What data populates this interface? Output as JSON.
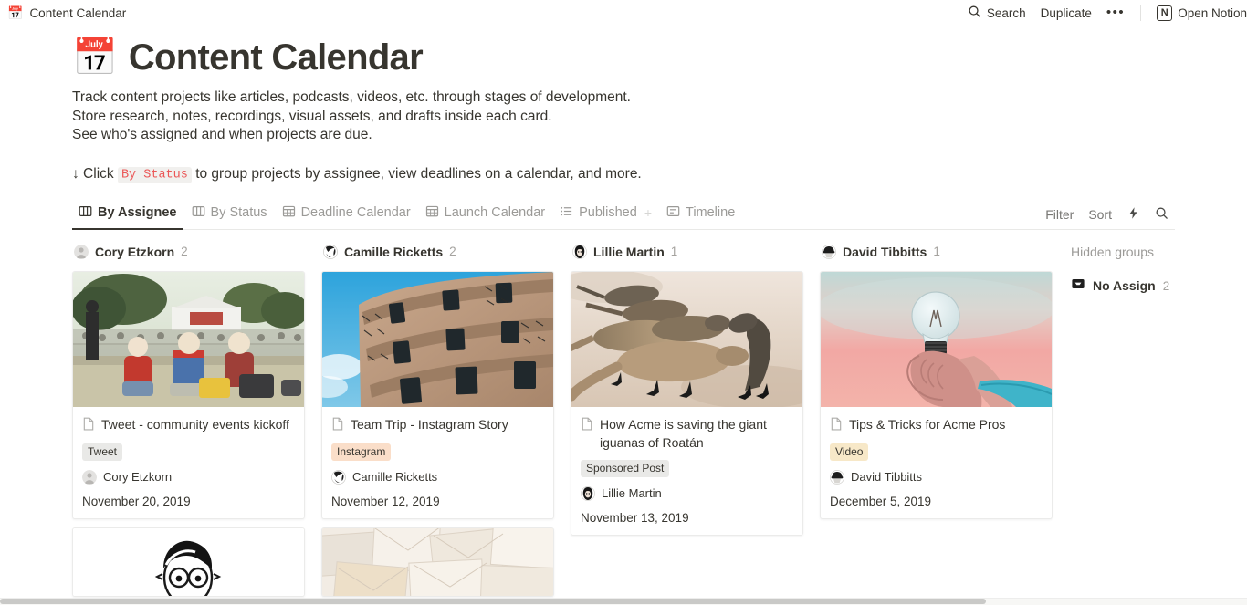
{
  "topbar": {
    "icon": "calendar-emoji",
    "title": "Content Calendar",
    "search_label": "Search",
    "search_icon": "search-icon",
    "duplicate_label": "Duplicate",
    "more_label": "•••",
    "open_notion_label": "Open Notion",
    "notion_logo": "N"
  },
  "page": {
    "emoji": "📅",
    "title": "Content Calendar",
    "description": [
      "Track content projects like articles, podcasts, videos, etc. through stages of development.",
      "Store research, notes, recordings, visual assets, and drafts inside each card.",
      "See who's assigned and when projects are due."
    ],
    "hint_prefix": "↓ Click",
    "hint_code": "By Status",
    "hint_suffix": "to group projects by assignee, view deadlines on a calendar, and more."
  },
  "tabs": [
    {
      "label": "By Assignee",
      "icon": "board-icon",
      "active": true
    },
    {
      "label": "By Status",
      "icon": "board-icon",
      "active": false
    },
    {
      "label": "Deadline Calendar",
      "icon": "calendar-icon",
      "active": false
    },
    {
      "label": "Launch Calendar",
      "icon": "calendar-icon",
      "active": false
    },
    {
      "label": "Published",
      "icon": "list-icon",
      "active": false,
      "plus": "+"
    },
    {
      "label": "Timeline",
      "icon": "timeline-icon",
      "active": false
    }
  ],
  "view_controls": {
    "filter_label": "Filter",
    "sort_label": "Sort",
    "lightning_icon": "lightning-icon",
    "search_icon": "search-icon"
  },
  "columns": [
    {
      "name": "Cory Etzkorn",
      "count": "2",
      "avatar": "avatar-placeholder",
      "cards": [
        {
          "image": "festival-crowd-photo",
          "title": "Tweet - community events kickoff",
          "tag": "Tweet",
          "tag_color": "gray",
          "assignee": "Cory Etzkorn",
          "date": "November 20, 2019"
        },
        {
          "image": "cartoon-face-illustration",
          "title": "",
          "tag": "",
          "tag_color": "",
          "assignee": "",
          "date": ""
        }
      ]
    },
    {
      "name": "Camille Ricketts",
      "count": "2",
      "avatar": "avatar-camille",
      "cards": [
        {
          "image": "casa-mila-building-photo",
          "title": "Team Trip - Instagram Story",
          "tag": "Instagram",
          "tag_color": "orange",
          "assignee": "Camille Ricketts",
          "date": "November 12, 2019"
        },
        {
          "image": "envelopes-photo",
          "title": "",
          "tag": "",
          "tag_color": "",
          "assignee": "",
          "date": ""
        }
      ]
    },
    {
      "name": "Lillie Martin",
      "count": "1",
      "avatar": "avatar-lillie",
      "cards": [
        {
          "image": "iguanas-photo",
          "title": "How Acme is saving the giant iguanas of Roatán",
          "tag": "Sponsored Post",
          "tag_color": "gray",
          "assignee": "Lillie Martin",
          "date": "November 13, 2019"
        }
      ]
    },
    {
      "name": "David Tibbitts",
      "count": "1",
      "avatar": "avatar-david",
      "cards": [
        {
          "image": "lightbulb-hand-photo",
          "title": "Tips & Tricks for Acme Pros",
          "tag": "Video",
          "tag_color": "yellow",
          "assignee": "David Tibbitts",
          "date": "December 5, 2019"
        }
      ]
    }
  ],
  "hidden_groups": {
    "label": "Hidden groups",
    "items": [
      {
        "name": "No Assign",
        "count": "2",
        "icon": "inbox-icon"
      }
    ]
  },
  "colors": {
    "text": "#37352f",
    "muted": "#9b9a97",
    "accent_code": "#eb5757",
    "tag_gray": "#e9e9e7",
    "tag_orange": "#fadec9",
    "tag_yellow": "#f7e8c8"
  }
}
